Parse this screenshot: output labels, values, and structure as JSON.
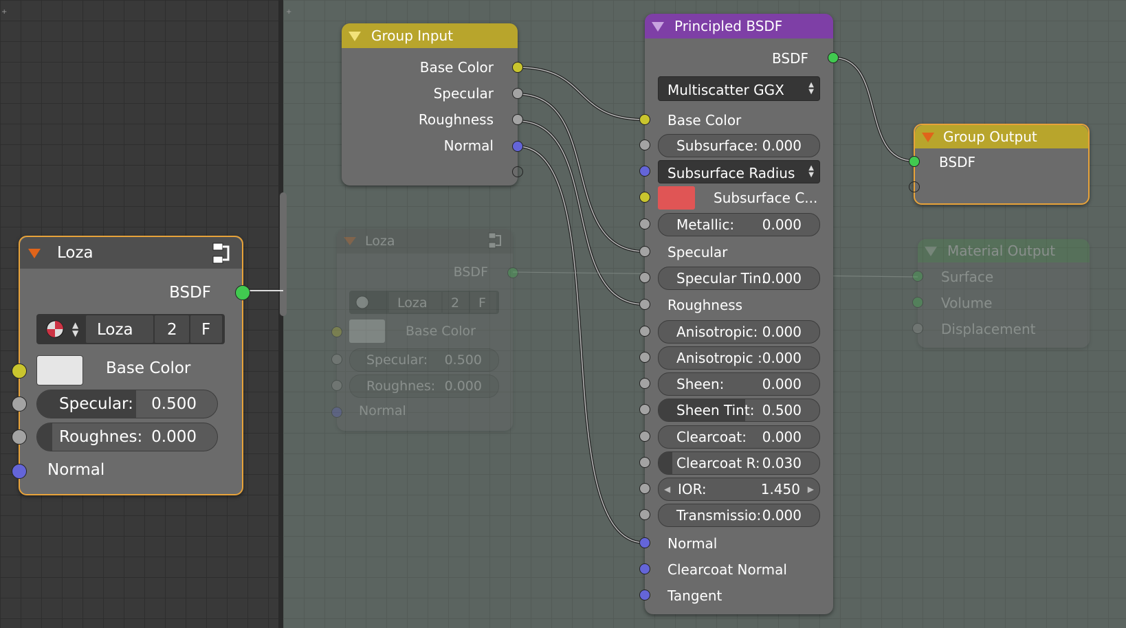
{
  "group_input": {
    "title": "Group Input",
    "outputs": [
      "Base Color",
      "Specular",
      "Roughness",
      "Normal"
    ]
  },
  "loza_node": {
    "title": "Loza",
    "output": "BSDF",
    "group_name": "Loza",
    "users": "2",
    "fake_user": "F",
    "base_color_label": "Base Color",
    "specular_label": "Specular:",
    "specular_value": "0.500",
    "roughness_label": "Roughnes:",
    "roughness_value": "0.000",
    "normal_label": "Normal",
    "base_color_swatch": "#e6e6e6"
  },
  "loza_ghost": {
    "title": "Loza",
    "output": "BSDF",
    "group_name": "Loza",
    "users": "2",
    "fake_user": "F",
    "base_color_label": "Base Color",
    "specular_label": "Specular:",
    "specular_value": "0.500",
    "roughness_label": "Roughnes:",
    "roughness_value": "0.000",
    "normal_label": "Normal"
  },
  "principled": {
    "title": "Principled BSDF",
    "output": "BSDF",
    "distribution": "Multiscatter GGX",
    "base_color": "Base Color",
    "subsurface_label": "Subsurface:",
    "subsurface_value": "0.000",
    "subsurface_method": "Subsurface Radius",
    "subsurface_color": "Subsurface C...",
    "subsurface_color_swatch": "#e05555",
    "metallic_label": "Metallic:",
    "metallic_value": "0.000",
    "specular": "Specular",
    "specular_tint_label": "Specular Tin:",
    "specular_tint_value": "0.000",
    "roughness": "Roughness",
    "anisotropic_label": "Anisotropic:",
    "anisotropic_value": "0.000",
    "anisotropic_rot_label": "Anisotropic :",
    "anisotropic_rot_value": "0.000",
    "sheen_label": "Sheen:",
    "sheen_value": "0.000",
    "sheen_tint_label": "Sheen Tint:",
    "sheen_tint_value": "0.500",
    "clearcoat_label": "Clearcoat:",
    "clearcoat_value": "0.000",
    "clearcoat_r_label": "Clearcoat R:",
    "clearcoat_r_value": "0.030",
    "ior_label": "IOR:",
    "ior_value": "1.450",
    "transmission_label": "Transmissio:",
    "transmission_value": "0.000",
    "normal": "Normal",
    "clearcoat_normal": "Clearcoat Normal",
    "tangent": "Tangent"
  },
  "group_output": {
    "title": "Group Output",
    "input": "BSDF"
  },
  "material_output": {
    "title": "Material Output",
    "inputs": [
      "Surface",
      "Volume",
      "Displacement"
    ]
  },
  "colors": {
    "group_header": "#b8a52c",
    "shader_header": "#7e3fa6",
    "output_header": "#4c8f4c",
    "selected_outline": "#e8a33a"
  }
}
